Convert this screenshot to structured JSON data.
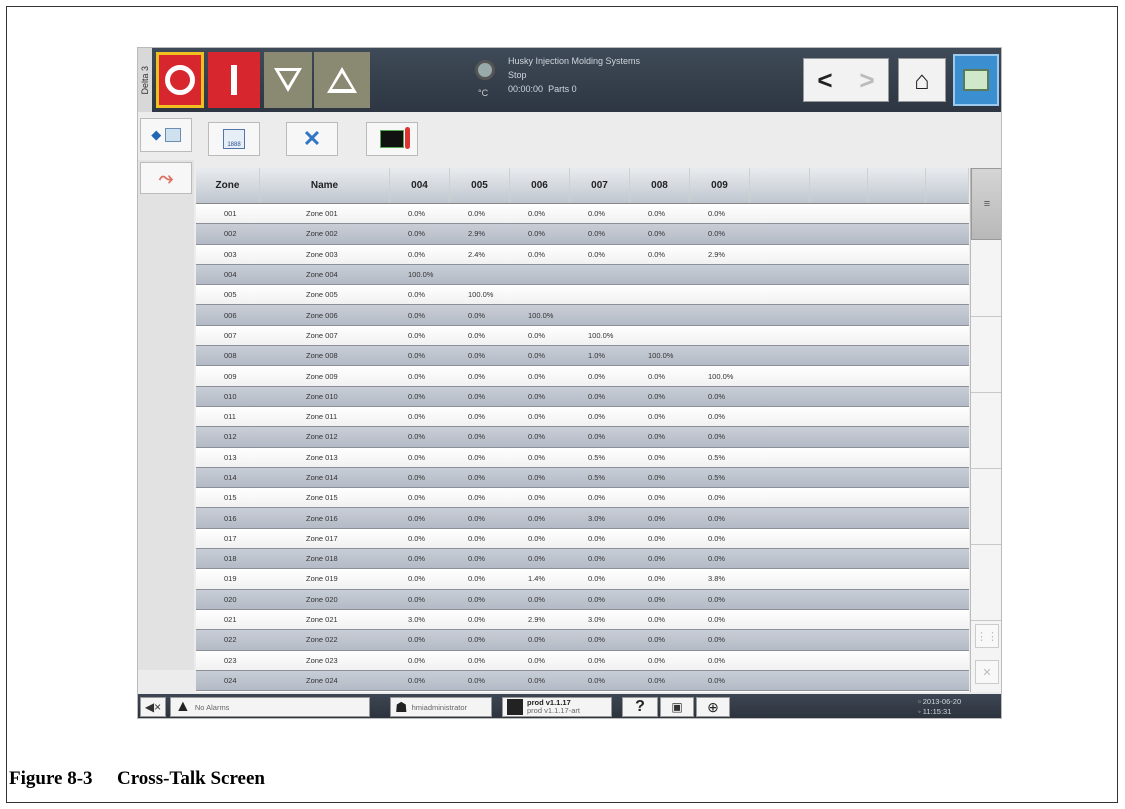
{
  "topbar": {
    "side_tab": "Delta 3",
    "status_title": "Husky Injection Molding Systems",
    "status_state": "Stop",
    "status_time": "00:00:00",
    "status_parts": "Parts 0",
    "temp_unit": "°C",
    "nav_back": "<",
    "nav_forward": ">",
    "home": "⌂"
  },
  "toolbar": {
    "back_icon": "◆",
    "tool1_label": "1888",
    "tool2_icon": "✕"
  },
  "rail": {
    "icon": "⤳"
  },
  "table": {
    "headers": [
      "Zone",
      "Name",
      "004",
      "005",
      "006",
      "007",
      "008",
      "009",
      "",
      "",
      "",
      ""
    ],
    "rows": [
      [
        "001",
        "Zone 001",
        "0.0%",
        "0.0%",
        "0.0%",
        "0.0%",
        "0.0%",
        "0.0%"
      ],
      [
        "002",
        "Zone 002",
        "0.0%",
        "2.9%",
        "0.0%",
        "0.0%",
        "0.0%",
        "0.0%"
      ],
      [
        "003",
        "Zone 003",
        "0.0%",
        "2.4%",
        "0.0%",
        "0.0%",
        "0.0%",
        "2.9%"
      ],
      [
        "004",
        "Zone 004",
        "100.0%",
        "",
        "",
        "",
        "",
        ""
      ],
      [
        "005",
        "Zone 005",
        "0.0%",
        "100.0%",
        "",
        "",
        "",
        ""
      ],
      [
        "006",
        "Zone 006",
        "0.0%",
        "0.0%",
        "100.0%",
        "",
        "",
        ""
      ],
      [
        "007",
        "Zone 007",
        "0.0%",
        "0.0%",
        "0.0%",
        "100.0%",
        "",
        ""
      ],
      [
        "008",
        "Zone 008",
        "0.0%",
        "0.0%",
        "0.0%",
        "1.0%",
        "100.0%",
        ""
      ],
      [
        "009",
        "Zone 009",
        "0.0%",
        "0.0%",
        "0.0%",
        "0.0%",
        "0.0%",
        "100.0%"
      ],
      [
        "010",
        "Zone 010",
        "0.0%",
        "0.0%",
        "0.0%",
        "0.0%",
        "0.0%",
        "0.0%"
      ],
      [
        "011",
        "Zone 011",
        "0.0%",
        "0.0%",
        "0.0%",
        "0.0%",
        "0.0%",
        "0.0%"
      ],
      [
        "012",
        "Zone 012",
        "0.0%",
        "0.0%",
        "0.0%",
        "0.0%",
        "0.0%",
        "0.0%"
      ],
      [
        "013",
        "Zone 013",
        "0.0%",
        "0.0%",
        "0.0%",
        "0.5%",
        "0.0%",
        "0.5%"
      ],
      [
        "014",
        "Zone 014",
        "0.0%",
        "0.0%",
        "0.0%",
        "0.5%",
        "0.0%",
        "0.5%"
      ],
      [
        "015",
        "Zone 015",
        "0.0%",
        "0.0%",
        "0.0%",
        "0.0%",
        "0.0%",
        "0.0%"
      ],
      [
        "016",
        "Zone 016",
        "0.0%",
        "0.0%",
        "0.0%",
        "3.0%",
        "0.0%",
        "0.0%"
      ],
      [
        "017",
        "Zone 017",
        "0.0%",
        "0.0%",
        "0.0%",
        "0.0%",
        "0.0%",
        "0.0%"
      ],
      [
        "018",
        "Zone 018",
        "0.0%",
        "0.0%",
        "0.0%",
        "0.0%",
        "0.0%",
        "0.0%"
      ],
      [
        "019",
        "Zone 019",
        "0.0%",
        "0.0%",
        "1.4%",
        "0.0%",
        "0.0%",
        "3.8%"
      ],
      [
        "020",
        "Zone 020",
        "0.0%",
        "0.0%",
        "0.0%",
        "0.0%",
        "0.0%",
        "0.0%"
      ],
      [
        "021",
        "Zone 021",
        "3.0%",
        "0.0%",
        "2.9%",
        "3.0%",
        "0.0%",
        "0.0%"
      ],
      [
        "022",
        "Zone 022",
        "0.0%",
        "0.0%",
        "0.0%",
        "0.0%",
        "0.0%",
        "0.0%"
      ],
      [
        "023",
        "Zone 023",
        "0.0%",
        "0.0%",
        "0.0%",
        "0.0%",
        "0.0%",
        "0.0%"
      ],
      [
        "024",
        "Zone 024",
        "0.0%",
        "0.0%",
        "0.0%",
        "0.0%",
        "0.0%",
        "0.0%"
      ]
    ]
  },
  "scroll": {
    "thumb_icon": "≡",
    "grid_icon": "⋮⋮",
    "close_icon": "✕"
  },
  "bottombar": {
    "mute_icon": "◀×",
    "alarm_icon": "▲",
    "alarm_text": "No Alarms",
    "user_icon": "☗",
    "user_text": "hmiadministrator",
    "version_line1": "prod v1.1.17",
    "version_line2": "prod v1.1.17-art",
    "help": "?",
    "snapshot_icon": "▣",
    "globe_icon": "⊕",
    "date": "2013-06-20",
    "time": "11:15:31"
  },
  "caption": {
    "number": "Figure 8-3",
    "title": "Cross-Talk Screen"
  }
}
